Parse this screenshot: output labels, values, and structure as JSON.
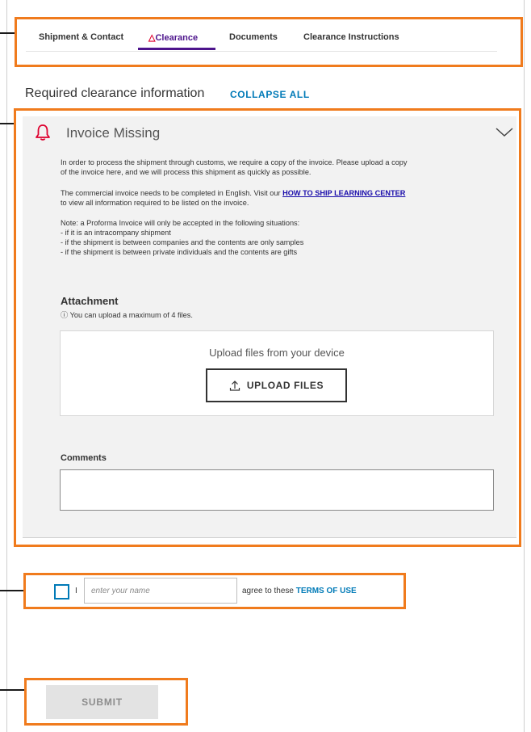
{
  "tabs": [
    {
      "label": "Shipment & Contact",
      "active": false
    },
    {
      "label": "Clearance",
      "active": true,
      "warning": true
    },
    {
      "label": "Documents",
      "active": false
    },
    {
      "label": "Clearance Instructions",
      "active": false
    }
  ],
  "section": {
    "title": "Required clearance information",
    "collapse_all": "COLLAPSE ALL"
  },
  "invoice_panel": {
    "title": "Invoice Missing",
    "intro_line1": "In order to process the shipment through customs, we require a copy of the invoice. Please upload a copy",
    "intro_line2": "of the invoice here, and we will process this shipment as quickly as possible.",
    "english_prefix": "The commercial invoice needs to be completed in English. Visit our",
    "learning_center_link": "HOW TO SHIP LEARNING CENTER",
    "english_suffix": "to view all information required to be listed on the invoice.",
    "proforma_note": "Note: a Proforma Invoice will only be accepted in the following situations:",
    "proforma_cases": [
      "- if it is an intracompany shipment",
      "- if the shipment is between companies and the contents are only samples",
      "- if the shipment is between private individuals and the contents are gifts"
    ]
  },
  "attachment": {
    "title": "Attachment",
    "note": "You can upload a maximum of 4 files.",
    "upload_prompt": "Upload files from your device",
    "upload_button": "UPLOAD FILES"
  },
  "comments": {
    "label": "Comments",
    "value": ""
  },
  "terms": {
    "i_label": "I",
    "name_placeholder": "enter your name",
    "name_value": "",
    "agree_text": "agree to these",
    "terms_link": "TERMS OF USE",
    "checked": false
  },
  "submit_label": "SUBMIT",
  "colors": {
    "highlight": "#f07b1d",
    "brand_purple": "#4d148c",
    "link_blue": "#007ab7",
    "alert_red": "#de002e"
  }
}
